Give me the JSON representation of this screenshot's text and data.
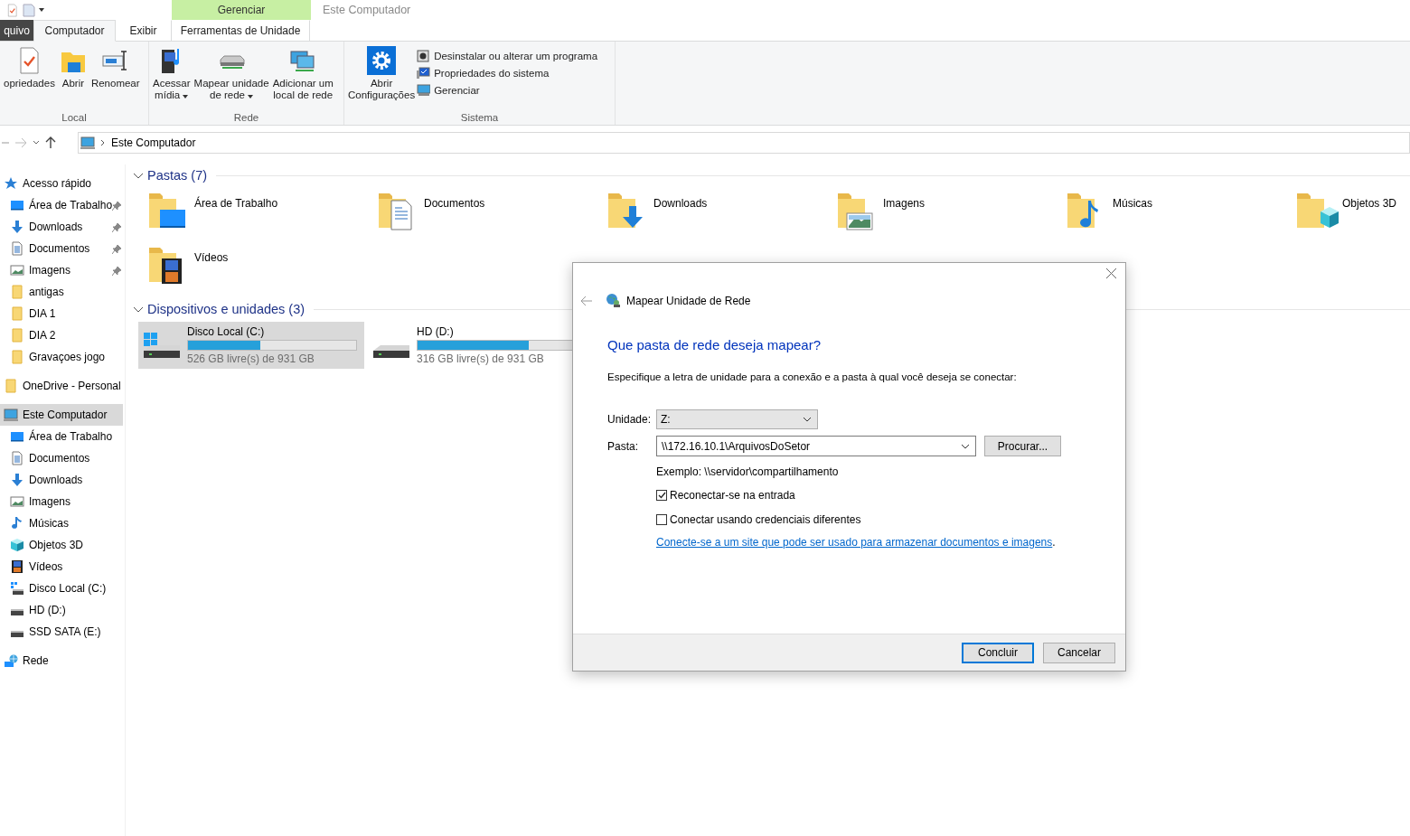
{
  "window": {
    "title": "Este Computador",
    "context_header": "Gerenciar"
  },
  "tabs": [
    {
      "label": "quivo",
      "kind": "file",
      "selected": false
    },
    {
      "label": "Computador",
      "kind": "tab",
      "selected": true
    },
    {
      "label": "Exibir",
      "kind": "tab",
      "selected": false
    },
    {
      "label": "Ferramentas de Unidade",
      "kind": "context",
      "selected": false
    }
  ],
  "ribbon": {
    "groups": [
      {
        "label": "Local",
        "buttons": [
          {
            "lines": [
              "opriedades"
            ],
            "kind": "properties",
            "dropdown": false
          },
          {
            "lines": [
              "Abrir"
            ],
            "kind": "open",
            "dropdown": false
          },
          {
            "lines": [
              "Renomear"
            ],
            "kind": "rename",
            "dropdown": false
          }
        ]
      },
      {
        "label": "Rede",
        "buttons": [
          {
            "lines": [
              "Acessar",
              "mídia"
            ],
            "kind": "media",
            "dropdown": true
          },
          {
            "lines": [
              "Mapear unidade",
              "de rede"
            ],
            "kind": "map",
            "dropdown": true
          },
          {
            "lines": [
              "Adicionar um",
              "local de rede"
            ],
            "kind": "netloc",
            "dropdown": false
          }
        ]
      },
      {
        "label": "Sistema",
        "buttons": [
          {
            "lines": [
              "Abrir",
              "Configurações"
            ],
            "kind": "settings",
            "dropdown": false
          }
        ],
        "small_buttons": [
          {
            "label": "Desinstalar ou alterar um programa",
            "kind": "uninstall"
          },
          {
            "label": "Propriedades do sistema",
            "kind": "sysprops"
          },
          {
            "label": "Gerenciar",
            "kind": "manage"
          }
        ]
      }
    ]
  },
  "address_bar": {
    "path": "Este Computador"
  },
  "sidebar": {
    "items": [
      {
        "label": "Acesso rápido",
        "kind": "star",
        "selected": false,
        "children": [
          {
            "label": "Área de Trabalho",
            "kind": "desktop",
            "pinned": true,
            "selected": false
          },
          {
            "label": "Downloads",
            "kind": "download",
            "pinned": true,
            "selected": false
          },
          {
            "label": "Documentos",
            "kind": "document",
            "pinned": true,
            "selected": false
          },
          {
            "label": "Imagens",
            "kind": "picture",
            "pinned": true,
            "selected": false
          },
          {
            "label": "antigas",
            "kind": "folder",
            "pinned": false,
            "selected": false
          },
          {
            "label": "DIA 1",
            "kind": "folder",
            "pinned": false,
            "selected": false
          },
          {
            "label": "DIA 2",
            "kind": "folder",
            "pinned": false,
            "selected": false
          },
          {
            "label": "Gravaçoes jogo",
            "kind": "folder",
            "pinned": false,
            "selected": false
          }
        ]
      },
      {
        "label": "OneDrive - Personal",
        "kind": "folder",
        "selected": false
      },
      {
        "label": "Este Computador",
        "kind": "computer",
        "selected": true,
        "children": [
          {
            "label": "Área de Trabalho",
            "kind": "desktop",
            "pinned": false,
            "selected": false
          },
          {
            "label": "Documentos",
            "kind": "document",
            "pinned": false,
            "selected": false
          },
          {
            "label": "Downloads",
            "kind": "download",
            "pinned": false,
            "selected": false
          },
          {
            "label": "Imagens",
            "kind": "picture",
            "pinned": false,
            "selected": false
          },
          {
            "label": "Músicas",
            "kind": "music",
            "pinned": false,
            "selected": false
          },
          {
            "label": "Objetos 3D",
            "kind": "cube",
            "pinned": false,
            "selected": false
          },
          {
            "label": "Vídeos",
            "kind": "film",
            "pinned": false,
            "selected": false
          },
          {
            "label": "Disco Local (C:)",
            "kind": "windrive",
            "pinned": false,
            "selected": false
          },
          {
            "label": "HD (D:)",
            "kind": "drive",
            "pinned": false,
            "selected": false
          },
          {
            "label": "SSD SATA (E:)",
            "kind": "drive",
            "pinned": false,
            "selected": false
          }
        ]
      },
      {
        "label": "Rede",
        "kind": "network",
        "selected": false
      }
    ]
  },
  "folders": {
    "title": "Pastas (7)",
    "expanded": true,
    "items": [
      {
        "label": "Área de Trabalho",
        "kind": "desktop"
      },
      {
        "label": "Documentos",
        "kind": "document"
      },
      {
        "label": "Downloads",
        "kind": "download"
      },
      {
        "label": "Imagens",
        "kind": "picture"
      },
      {
        "label": "Músicas",
        "kind": "music"
      },
      {
        "label": "Objetos 3D",
        "kind": "cube"
      },
      {
        "label": "Vídeos",
        "kind": "film"
      }
    ]
  },
  "devices": {
    "title": "Dispositivos e unidades (3)",
    "expanded": true,
    "items": [
      {
        "name": "Disco Local (C:)",
        "free": "526 GB livre(s) de 931 GB",
        "level": 0.43,
        "kind": "windrive",
        "selected": true
      },
      {
        "name": "HD (D:)",
        "free": "316 GB livre(s) de 931 GB",
        "level": 0.66,
        "kind": "drive",
        "selected": false
      }
    ]
  },
  "dialog": {
    "title": "Mapear Unidade de Rede",
    "heading": "Que pasta de rede deseja mapear?",
    "instruction": "Especifique a letra de unidade para a conexão e a pasta à qual você deseja se conectar:",
    "drive": {
      "label": "Unidade:",
      "value": "Z:"
    },
    "folder": {
      "label": "Pasta:",
      "value": "\\\\172.16.10.1\\ArquivosDoSetor"
    },
    "browse": "Procurar...",
    "example": "Exemplo: \\\\servidor\\compartilhamento",
    "checkboxes": [
      {
        "label": "Reconectar-se na entrada",
        "checked": true
      },
      {
        "label": "Conectar usando credenciais diferentes",
        "checked": false
      }
    ],
    "link": "Conecte-se a um site que pode ser usado para armazenar documentos e imagens",
    "link_suffix": ".",
    "buttons": [
      {
        "label": "Concluir",
        "default": true
      },
      {
        "label": "Cancelar",
        "default": false
      }
    ]
  }
}
